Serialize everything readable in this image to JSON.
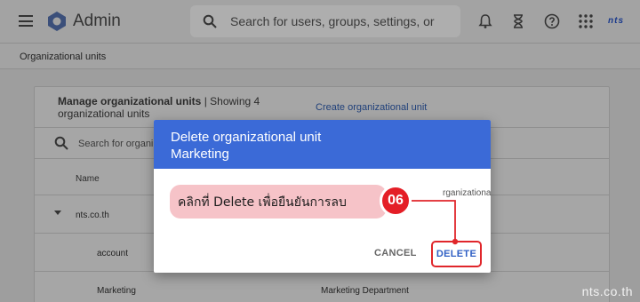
{
  "app": {
    "title": "Admin",
    "brand": "nts"
  },
  "search": {
    "placeholder": "Search for users, groups, settings, or"
  },
  "breadcrumb": {
    "label": "Organizational units"
  },
  "card": {
    "title_bold": "Manage organizational units",
    "title_rest": " | Showing 4 organizational units",
    "create_link": "Create organizational unit",
    "search_placeholder": "Search for organi",
    "column_name": "Name",
    "rows": [
      {
        "name": "nts.co.th",
        "description": ""
      },
      {
        "name": "account",
        "description": ""
      },
      {
        "name": "Marketing",
        "description": "Marketing Department"
      }
    ]
  },
  "dialog": {
    "title_line1": "Delete organizational unit",
    "title_line2": "Marketing",
    "body_fragment": "rganizational",
    "cancel_label": "CANCEL",
    "delete_label": "DELETE"
  },
  "annotation": {
    "text": "คลิกที่ Delete เพื่อยืนยันการลบ",
    "step": "06",
    "color": "#e41e26"
  },
  "watermark": "nts.co.th",
  "colors": {
    "dialog_header": "#3b6ad7",
    "delete_button_text": "#2f5fc4",
    "overlay": "#9e9e9e"
  }
}
